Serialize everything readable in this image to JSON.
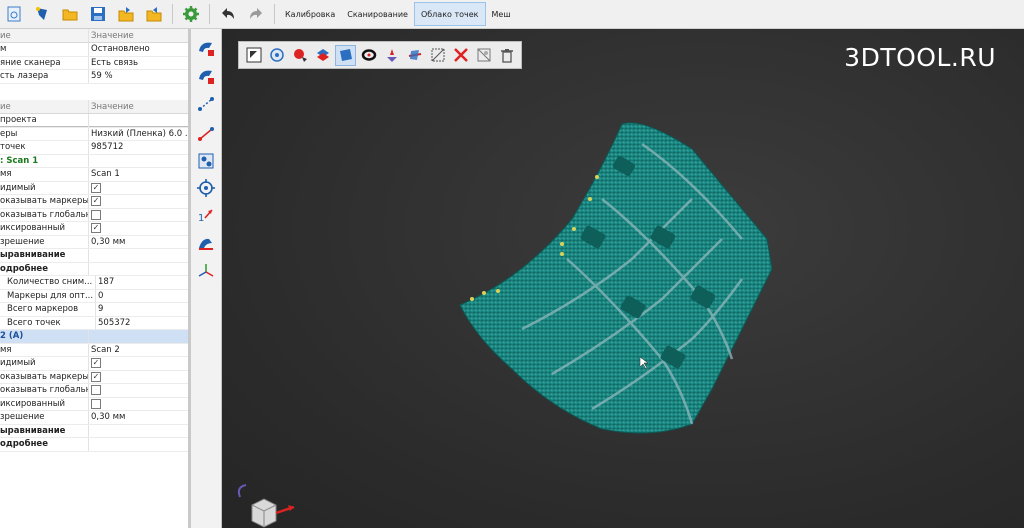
{
  "toolbar": {
    "icons": [
      "new-project-icon",
      "open-scan-icon",
      "open-folder-icon",
      "save-icon",
      "export-icon",
      "import-icon",
      "settings-gear-icon",
      "undo-icon",
      "redo-icon"
    ],
    "tabs": [
      {
        "label": "Калибровка",
        "active": false
      },
      {
        "label": "Сканирование",
        "active": false
      },
      {
        "label": "Облако точек",
        "active": true
      },
      {
        "label": "Меш",
        "active": false
      }
    ]
  },
  "watermark": "3DTOOL.RU",
  "scanner_panel": {
    "header": {
      "name": "ие",
      "value": "Значение"
    },
    "rows": [
      {
        "name": "м",
        "value": "Остановлено"
      },
      {
        "name": "яние сканера",
        "value": "Есть связь"
      },
      {
        "name": "сть лазера",
        "value": "59 %"
      }
    ]
  },
  "project_panel": {
    "header": {
      "name": "ие",
      "value": "Значение"
    },
    "rows": [
      {
        "name": "проекта",
        "value": "",
        "style": ""
      },
      {
        "name": "еры",
        "value": "Низкий (Пленка) 6.0 ...",
        "style": ""
      },
      {
        "name": "точек",
        "value": "985712",
        "style": ""
      },
      {
        "name": ": Scan 1",
        "value": "",
        "style": "green"
      },
      {
        "name": "мя",
        "value": "Scan 1",
        "style": ""
      },
      {
        "name": "идимый",
        "value": "",
        "check": true,
        "style": ""
      },
      {
        "name": "оказывать маркеры",
        "value": "",
        "check": true,
        "style": ""
      },
      {
        "name": "оказывать глобальн...",
        "value": "",
        "check": false,
        "style": ""
      },
      {
        "name": "иксированный",
        "value": "",
        "check": true,
        "style": ""
      },
      {
        "name": "зрешение",
        "value": "0,30 мм",
        "style": ""
      },
      {
        "name": "ыравнивание",
        "value": "",
        "style": "bold"
      },
      {
        "name": "одробнее",
        "value": "",
        "style": "bold"
      },
      {
        "name": "Количество сним...",
        "value": "187",
        "style": "indent"
      },
      {
        "name": "Маркеры для опт...",
        "value": "0",
        "style": "indent"
      },
      {
        "name": "Всего маркеров",
        "value": "9",
        "style": "indent"
      },
      {
        "name": "Всего точек",
        "value": "505372",
        "style": "indent"
      },
      {
        "name": "2 (A)",
        "value": "",
        "style": "sel"
      },
      {
        "name": "мя",
        "value": "Scan 2",
        "style": ""
      },
      {
        "name": "идимый",
        "value": "",
        "check": true,
        "style": ""
      },
      {
        "name": "оказывать маркеры",
        "value": "",
        "check": true,
        "style": ""
      },
      {
        "name": "оказывать глобальн...",
        "value": "",
        "check": false,
        "style": ""
      },
      {
        "name": "иксированный",
        "value": "",
        "check": false,
        "style": ""
      },
      {
        "name": "зрешение",
        "value": "0,30 мм",
        "style": ""
      },
      {
        "name": "ыравнивание",
        "value": "",
        "style": "bold"
      },
      {
        "name": "одробнее",
        "value": "",
        "style": "bold"
      }
    ]
  },
  "side_toolbar": {
    "icons": [
      "scan-delete-icon",
      "scan-lock-icon",
      "align-points-icon",
      "markers-align-icon",
      "select-region-icon",
      "target-icon",
      "numbering-icon",
      "hand-measure-icon",
      "axis-icon"
    ]
  },
  "view_toolbar": {
    "icons": [
      "fit-view-icon",
      "view-rotate-icon",
      "select-point-icon",
      "layers-icon",
      "select-surface-icon",
      "lasso-icon",
      "brush-icon",
      "plane-cut-icon",
      "hide-icon",
      "delete-selected-icon",
      "invert-icon",
      "trash-icon"
    ]
  },
  "colors": {
    "toolbar_bg": "#f0f0f0",
    "viewport_bg": "#2f2f2f",
    "model": "#1f8c86",
    "accent_blue": "#1b4f9a"
  }
}
